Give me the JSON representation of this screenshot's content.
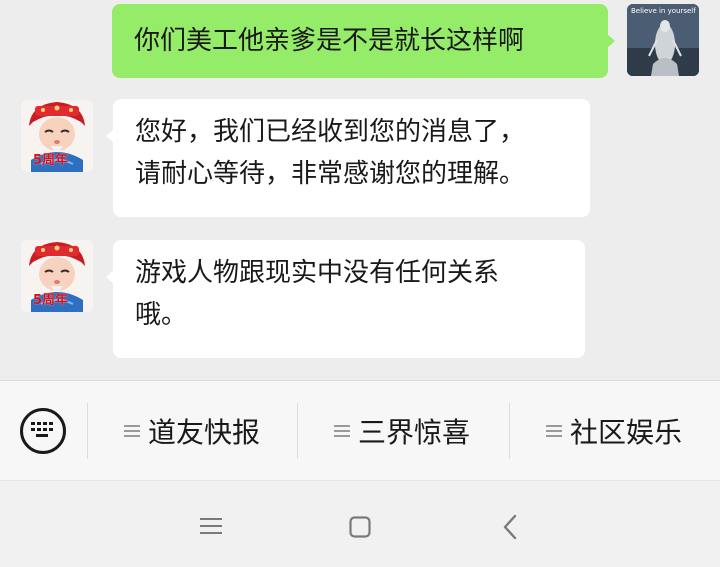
{
  "conversation": {
    "messages": [
      {
        "sender": "user",
        "lines": [
          "你们美工他亲爹是不是就长这样啊"
        ],
        "avatar_caption": "Believe in yourself"
      },
      {
        "sender": "bot",
        "lines": [
          "您好，我们已经收到您的消息了，",
          "请耐心等待，非常感谢您的理解。"
        ],
        "avatar_badge": "5周年"
      },
      {
        "sender": "bot",
        "lines": [
          "游戏人物跟现实中没有任何关系",
          "哦。"
        ],
        "avatar_badge": "5周年"
      }
    ]
  },
  "menu": {
    "keyboard_icon": "keyboard-icon",
    "items": [
      {
        "label": "道友快报",
        "icon": "menu-lines-icon"
      },
      {
        "label": "三界惊喜",
        "icon": "menu-lines-icon"
      },
      {
        "label": "社区娱乐",
        "icon": "menu-lines-icon"
      }
    ]
  },
  "navigation": {
    "buttons": [
      "menu-icon",
      "home-icon",
      "back-icon"
    ]
  },
  "colors": {
    "user_bubble": "#95ec69",
    "bot_bubble": "#ffffff",
    "chat_background": "#ededed",
    "anniversary_red": "#d40f1a"
  }
}
